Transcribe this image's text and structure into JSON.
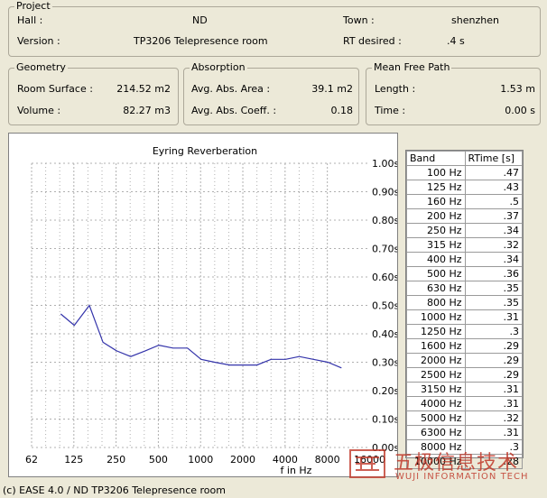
{
  "project": {
    "title": "Project",
    "hall_label": "Hall :",
    "hall_value": "ND",
    "town_label": "Town :",
    "town_value": "shenzhen",
    "version_label": "Version :",
    "version_value": "TP3206 Telepresence  room",
    "rt_desired_label": "RT desired :",
    "rt_desired_value": ".4 s"
  },
  "geometry": {
    "title": "Geometry",
    "surface_label": "Room Surface :",
    "surface_value": "214.52 m2",
    "volume_label": "Volume :",
    "volume_value": "82.27 m3"
  },
  "absorption": {
    "title": "Absorption",
    "area_label": "Avg. Abs. Area :",
    "area_value": "39.1 m2",
    "coeff_label": "Avg. Abs. Coeff. :",
    "coeff_value": "0.18"
  },
  "mfp": {
    "title": "Mean Free Path",
    "length_label": "Length :",
    "length_value": "1.53 m",
    "time_label": "Time :",
    "time_value": "0.00 s"
  },
  "chart_data": {
    "type": "line",
    "title": "Eyring Reverberation",
    "xlabel": "f in Hz",
    "ylabel": "",
    "x_ticks": [
      "62",
      "125",
      "250",
      "500",
      "1000",
      "2000",
      "4000",
      "8000",
      "16000"
    ],
    "y_ticks": [
      "1.00s",
      "0.90s",
      "0.80s",
      "0.70s",
      "0.60s",
      "0.50s",
      "0.40s",
      "0.30s",
      "0.20s",
      "0.10s",
      "0.00s"
    ],
    "ylim": [
      0,
      1.0
    ],
    "x_scale": "log",
    "grid": true,
    "line_color": "#3333aa",
    "x": [
      100,
      125,
      160,
      200,
      250,
      315,
      400,
      500,
      630,
      800,
      1000,
      1250,
      1600,
      2000,
      2500,
      3150,
      4000,
      5000,
      6300,
      8000,
      10000
    ],
    "values": [
      0.47,
      0.43,
      0.5,
      0.37,
      0.34,
      0.32,
      0.34,
      0.36,
      0.35,
      0.35,
      0.31,
      0.3,
      0.29,
      0.29,
      0.29,
      0.31,
      0.31,
      0.32,
      0.31,
      0.3,
      0.28
    ]
  },
  "table": {
    "headers": [
      "Band",
      "RTime [s]"
    ],
    "rows": [
      [
        "100 Hz",
        ".47"
      ],
      [
        "125 Hz",
        ".43"
      ],
      [
        "160 Hz",
        ".5"
      ],
      [
        "200 Hz",
        ".37"
      ],
      [
        "250 Hz",
        ".34"
      ],
      [
        "315 Hz",
        ".32"
      ],
      [
        "400 Hz",
        ".34"
      ],
      [
        "500 Hz",
        ".36"
      ],
      [
        "630 Hz",
        ".35"
      ],
      [
        "800 Hz",
        ".35"
      ],
      [
        "1000 Hz",
        ".31"
      ],
      [
        "1250 Hz",
        ".3"
      ],
      [
        "1600 Hz",
        ".29"
      ],
      [
        "2000 Hz",
        ".29"
      ],
      [
        "2500 Hz",
        ".29"
      ],
      [
        "3150 Hz",
        ".31"
      ],
      [
        "4000 Hz",
        ".31"
      ],
      [
        "5000 Hz",
        ".32"
      ],
      [
        "6300 Hz",
        ".31"
      ],
      [
        "8000 Hz",
        ".3"
      ],
      [
        "10000 Hz",
        ".28"
      ]
    ]
  },
  "footer": "(c) EASE 4.0  / ND TP3206 Telepresence  room",
  "watermark": {
    "cn": "五极信息技术",
    "en": "WUJI INFORMATION TECH"
  },
  "colors": {
    "background": "#ECE9D8",
    "border": "#ACA899",
    "line": "#3333aa",
    "grid": "#b0b0b0"
  }
}
